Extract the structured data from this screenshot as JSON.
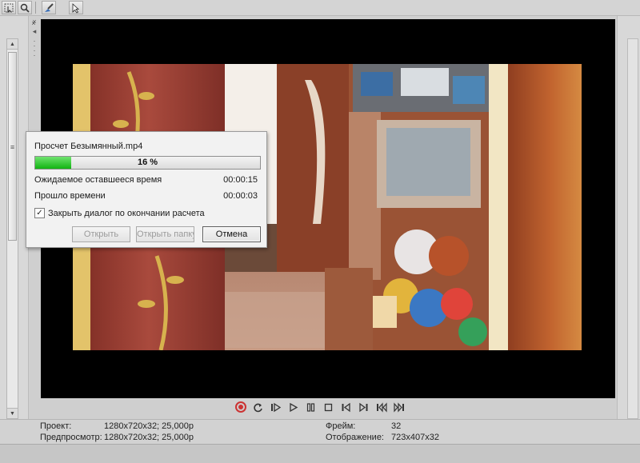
{
  "toolbar": {
    "buttons": [
      {
        "icon": "select-arrow-icon"
      },
      {
        "icon": "zoom-icon"
      },
      {
        "icon": "brush-icon"
      },
      {
        "icon": "cursor-help-icon"
      }
    ]
  },
  "transport": {
    "buttons": [
      {
        "icon": "record-icon"
      },
      {
        "icon": "loop-icon"
      },
      {
        "icon": "play-from-start-icon"
      },
      {
        "icon": "play-icon"
      },
      {
        "icon": "pause-icon"
      },
      {
        "icon": "stop-icon"
      },
      {
        "icon": "prev-frame-icon"
      },
      {
        "icon": "next-frame-icon"
      },
      {
        "icon": "go-to-start-icon"
      },
      {
        "icon": "go-to-end-icon"
      }
    ],
    "colors": {
      "record": "#cc3333"
    }
  },
  "status": {
    "project_label": "Проект:",
    "project_value": "1280x720x32; 25,000p",
    "preview_label": "Предпросмотр:",
    "preview_value": "1280x720x32; 25,000p",
    "frame_label": "Фрейм:",
    "frame_value": "32",
    "display_label": "Отображение:",
    "display_value": "723x407x32"
  },
  "dialog": {
    "title": "Просчет Безымянный.mp4",
    "progress_percent": 16,
    "progress_text": "16 %",
    "remaining_label": "Ожидаемое оставшееся время",
    "remaining_value": "00:00:15",
    "elapsed_label": "Прошло времени",
    "elapsed_value": "00:00:03",
    "close_checkbox_label": "Закрыть диалог по окончании расчета",
    "close_checkbox_checked": true,
    "open_button": "Открыть",
    "open_folder_button": "Открыть папку",
    "cancel_button": "Отмена",
    "colors": {
      "progress_fill": "#19b919"
    }
  }
}
